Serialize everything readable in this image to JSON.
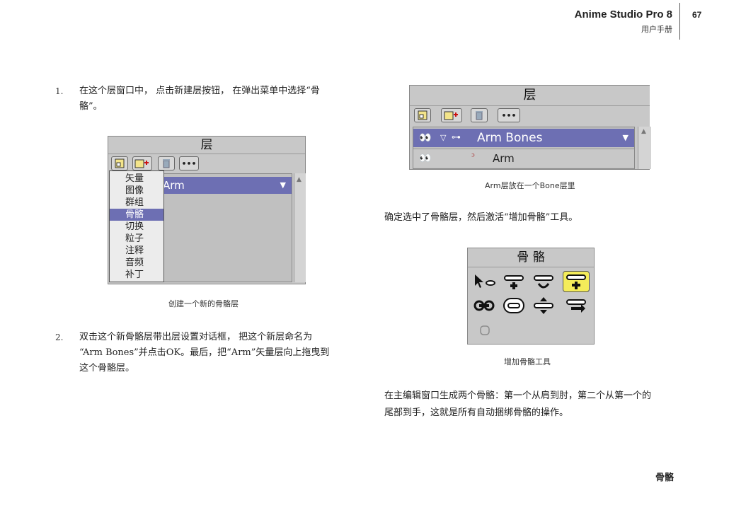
{
  "header": {
    "title": "Anime Studio Pro 8",
    "subtitle": "用户手册",
    "page_number": "67"
  },
  "left": {
    "step1": {
      "num": "1.",
      "line1": "在这个层窗口中， 点击新建层按钮， 在弹出菜单中选择“骨",
      "line2": "骼”。"
    },
    "fig1": {
      "title": "层",
      "layer_name": "Arm",
      "menu_items": [
        "矢量",
        "图像",
        "群组",
        "骨骼",
        "切换",
        "粒子",
        "注释",
        "音频",
        "补丁"
      ],
      "selected_item": "骨骼",
      "more_label": "•••",
      "caption": "创建一个新的骨骼层"
    },
    "step2": {
      "num": "2.",
      "line1": "双击这个新骨骼层带出层设置对话框， 把这个新层命名为",
      "line2": "“Arm Bones”并点击OK。最后，把“Arm”矢量层向上拖曳到",
      "line3": "这个骨骼层。"
    }
  },
  "right": {
    "fig2": {
      "title": "层",
      "more_label": "•••",
      "parent_layer": "Arm Bones",
      "child_layer": "Arm",
      "caption": "Arm层放在一个Bone层里"
    },
    "para1": "确定选中了骨骼层，然后激活“增加骨骼”工具。",
    "fig3": {
      "title": "骨 骼",
      "caption": "增加骨骼工具"
    },
    "para2_line1": "在主编辑窗口生成两个骨骼：第一个从肩到肘，第二个从第一个的",
    "para2_line2": "尾部到手，这就是所有自动捆绑骨骼的操作。"
  },
  "footer": {
    "section": "骨骼"
  },
  "colors": {
    "selection": "#6d6fb3",
    "panel": "#c8c8c8",
    "highlight_tool": "#f4ec5a"
  }
}
